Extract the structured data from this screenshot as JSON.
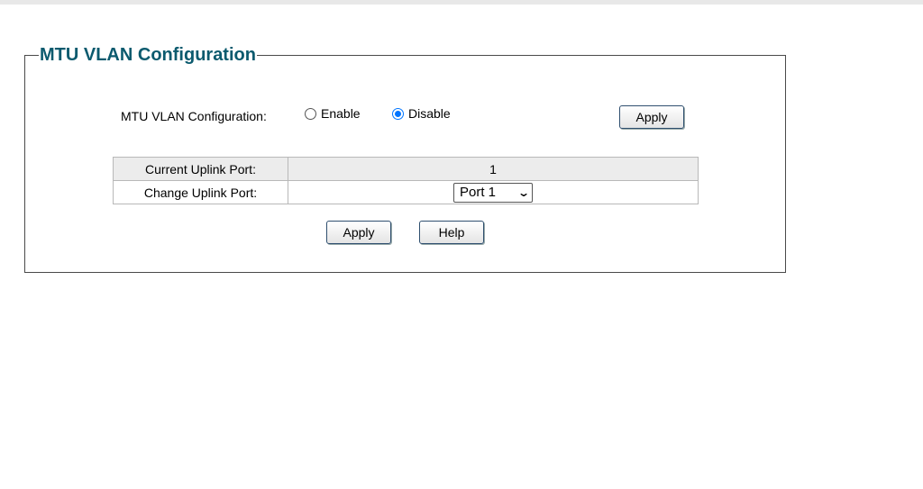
{
  "panel": {
    "title": "MTU VLAN Configuration"
  },
  "mtu_vlan": {
    "label": "MTU VLAN Configuration:",
    "options": [
      {
        "label": "Enable",
        "checked": false
      },
      {
        "label": "Disable",
        "checked": true
      }
    ],
    "apply_label": "Apply"
  },
  "table": {
    "rows": [
      {
        "label": "Current Uplink Port:",
        "value": "1"
      },
      {
        "label": "Change Uplink Port:",
        "value": "Port 1"
      }
    ]
  },
  "buttons": {
    "apply_label": "Apply",
    "help_label": "Help"
  },
  "colors": {
    "title": "#0b5a6e",
    "radio_accent": "#0075ff",
    "row_shade": "#ececec"
  },
  "icons": {
    "dropdown": "chevron-down-icon"
  }
}
